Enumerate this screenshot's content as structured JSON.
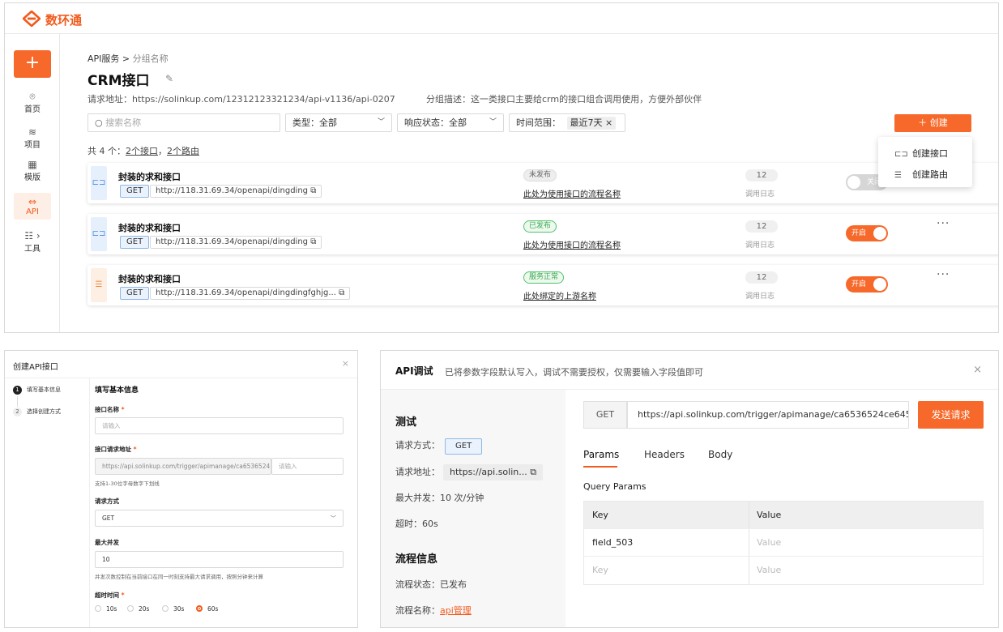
{
  "app": {
    "logo_text": "数环通"
  },
  "sidebar": {
    "add_label": "+",
    "items": [
      {
        "icon": "home-icon",
        "glyph": "⌾",
        "label": "首页"
      },
      {
        "icon": "project-icon",
        "glyph": "≋",
        "label": "项目"
      },
      {
        "icon": "template-icon",
        "glyph": "▦",
        "label": "模版"
      },
      {
        "icon": "api-icon",
        "glyph": "⇔",
        "label": "API"
      },
      {
        "icon": "tools-icon",
        "glyph": "☷ ›",
        "label": "工具"
      }
    ]
  },
  "header": {
    "breadcrumb_root": "API服务 >",
    "breadcrumb_current": "分组名称",
    "title": "CRM接口",
    "request_url": "请求地址：https://solinkup.com/12312123321234/api-v1136/api-0207",
    "group_desc": "分组描述：这一类接口主要给crm的接口组合调用使用，方便外部伙伴"
  },
  "filters": {
    "search_placeholder": "搜索名称",
    "type_label": "类型：全部",
    "response_label": "响应状态：全部",
    "time_label": "时间范围：",
    "time_value": "最近7天",
    "time_clear": "×",
    "create_label": "＋ 创建"
  },
  "summary": {
    "prefix": "共 4 个：",
    "interfaces": "2个接口",
    "sep": "，",
    "routes": "2个路由"
  },
  "create_menu": {
    "item1": "创建接口",
    "item2": "创建路由"
  },
  "rows": [
    {
      "name": "封装的求和接口",
      "method": "GET",
      "url": "http://118.31.69.34/openapi/dingding",
      "status": "未发布",
      "flow": "此处为使用接口的流程名称",
      "count": "12",
      "count_label": "调用日志",
      "toggle": "关闭"
    },
    {
      "name": "封装的求和接口",
      "method": "GET",
      "url": "http://118.31.69.34/openapi/dingding",
      "status": "已发布",
      "flow": "此处为使用接口的流程名称",
      "count": "12",
      "count_label": "调用日志",
      "toggle": "开启"
    },
    {
      "name": "封装的求和接口",
      "method": "GET",
      "url": "http://118.31.69.34/openapi/dingdingfghjg...",
      "status": "服务正常",
      "flow": "此处绑定的上游名称",
      "count": "12",
      "count_label": "调用日志",
      "toggle": "开启"
    }
  ],
  "create_dialog": {
    "title": "创建API接口",
    "steps": [
      {
        "num": "1",
        "label": "填写基本信息"
      },
      {
        "num": "2",
        "label": "选择创建方式"
      }
    ],
    "section_title": "填写基本信息",
    "name_label": "接口名称",
    "name_placeholder": "请输入",
    "url_label": "接口请求地址",
    "url_prefix": "https://api.solinkup.com/trigger/apimanage/ca6536524...",
    "url_placeholder": "请输入",
    "url_hint": "支持1-30位字母数字下划线",
    "method_label": "请求方式",
    "method_value": "GET",
    "concurrency_label": "最大并发",
    "concurrency_value": "10",
    "concurrency_hint": "并发次数控制在当前接口在同一时刻支持最大请求调用，按照分钟来计算",
    "timeout_label": "超时时间",
    "timeout_options": [
      "10s",
      "20s",
      "30s",
      "60s"
    ],
    "timeout_selected": "60s"
  },
  "debug": {
    "title": "API调试",
    "desc": "已将参数字段默认写入，调试不需要授权，仅需要输入字段值即可",
    "test_title": "测试",
    "method_label": "请求方式：",
    "method_value": "GET",
    "url_label": "请求地址：",
    "url_value": "https://api.solin...",
    "concurrency": "最大并发：10 次/分钟",
    "timeout": "超时：60s",
    "flow_title": "流程信息",
    "flow_status": "流程状态：已发布",
    "flow_name_label": "流程名称：",
    "flow_name_value": "api管理",
    "req_method": "GET",
    "req_url": "https://api.solinkup.com/trigger/apimanage/ca6536524ce645c",
    "send_label": "发送请求",
    "tabs": [
      "Params",
      "Headers",
      "Body"
    ],
    "query_title": "Query Params",
    "table": {
      "headers": [
        "Key",
        "Value"
      ],
      "rows": [
        {
          "key": "field_503",
          "value": "Value"
        },
        {
          "key": "Key",
          "value": "Value"
        }
      ]
    }
  },
  "colors": {
    "accent": "#f6692a",
    "green": "#3aa852",
    "blue": "#4a8ae0"
  }
}
